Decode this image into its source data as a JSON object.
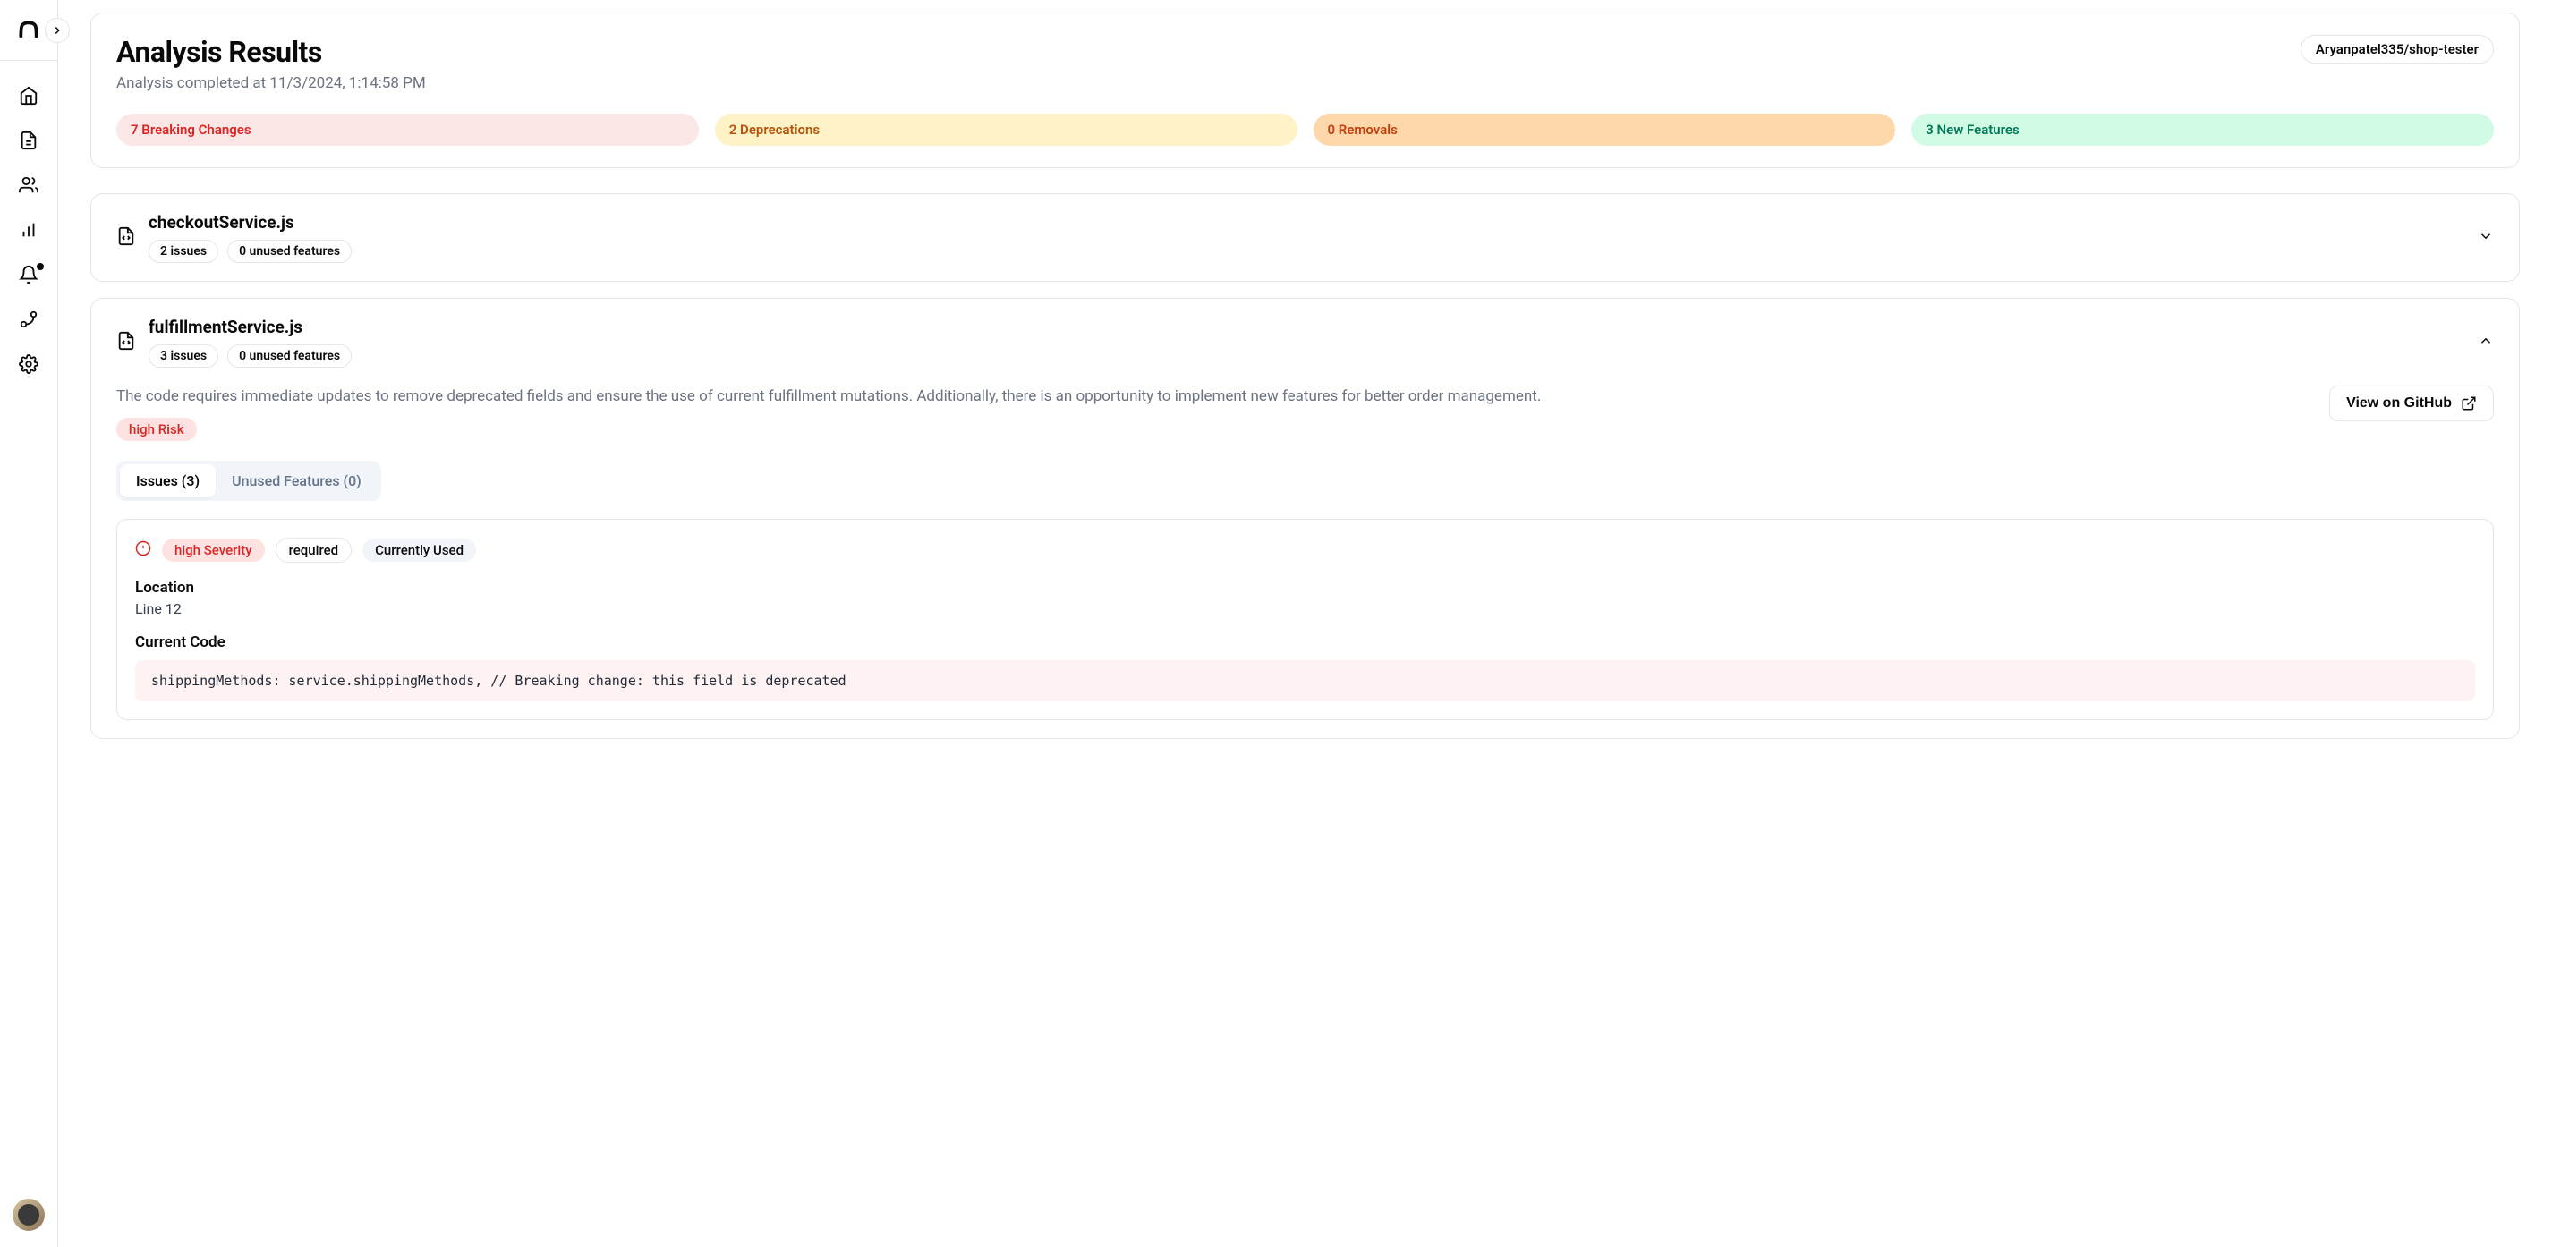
{
  "header": {
    "title": "Analysis Results",
    "subtitle": "Analysis completed at 11/3/2024, 1:14:58 PM",
    "repo": "Aryanpatel335/shop-tester"
  },
  "stats": {
    "breaking": "7 Breaking Changes",
    "deprecations": "2 Deprecations",
    "removals": "0 Removals",
    "features": "3 New Features"
  },
  "files": [
    {
      "name": "checkoutService.js",
      "issues_badge": "2 issues",
      "unused_badge": "0 unused features"
    },
    {
      "name": "fulfillmentService.js",
      "issues_badge": "3 issues",
      "unused_badge": "0 unused features",
      "description": "The code requires immediate updates to remove deprecated fields and ensure the use of current fulfillment mutations. Additionally, there is an opportunity to implement new features for better order management.",
      "risk": "high Risk",
      "github_btn": "View on GitHub",
      "tabs": {
        "issues": "Issues (3)",
        "unused": "Unused Features (0)"
      },
      "issue": {
        "severity": "high Severity",
        "required": "required",
        "currently_used": "Currently Used",
        "location_label": "Location",
        "location_value": "Line 12",
        "current_code_label": "Current Code",
        "current_code": "shippingMethods: service.shippingMethods, // Breaking change: this field is deprecated"
      }
    }
  ]
}
